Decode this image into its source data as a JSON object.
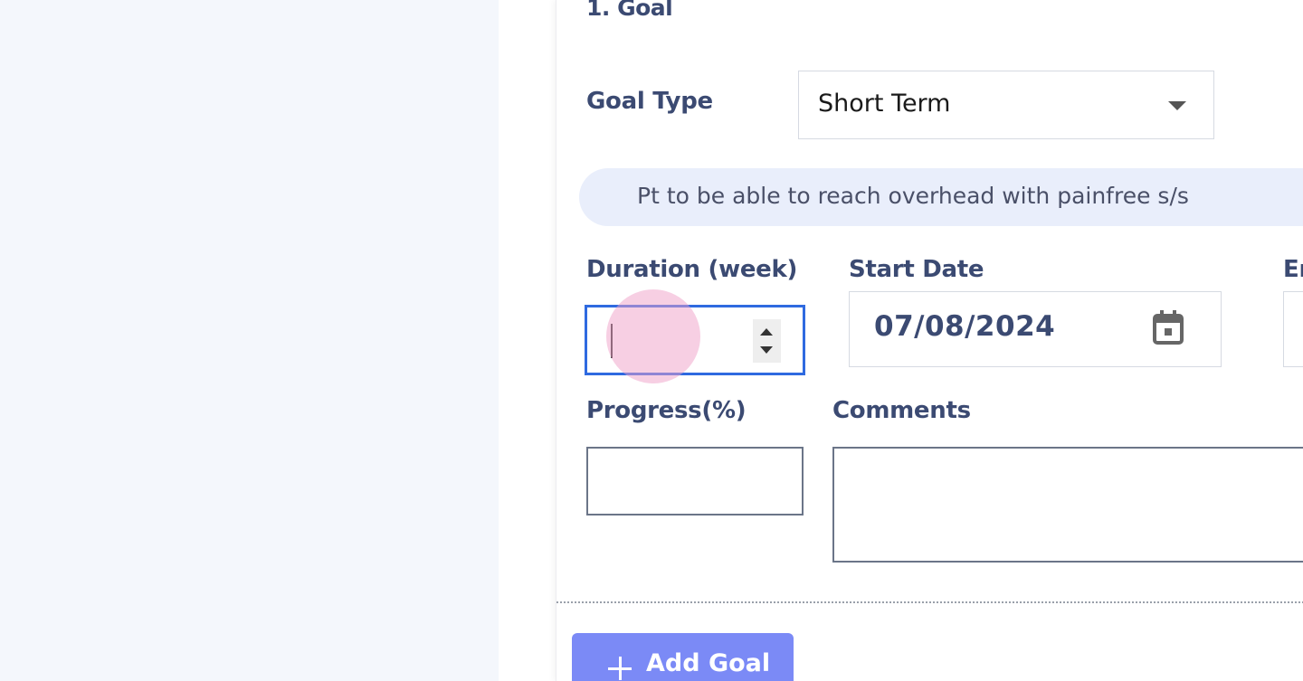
{
  "goal_section": {
    "title": "1. Goal",
    "goal_type_label": "Goal Type",
    "goal_type_value": "Short Term",
    "goal_description": "Pt to be able to reach overhead with painfree s/s",
    "duration_label": "Duration (week)",
    "duration_value": "",
    "start_date_label": "Start Date",
    "start_date_value": "07/08/2024",
    "end_date_label": "En",
    "progress_label": "Progress(%)",
    "progress_value": "",
    "comments_label": "Comments",
    "comments_value": ""
  },
  "actions": {
    "add_goal_label": "Add Goal"
  },
  "icons": {
    "select": "chevron-down-icon",
    "calendar": "calendar-icon",
    "add": "plus-icon"
  },
  "colors": {
    "label": "#3b4a72",
    "focus_border": "#2f6ae0",
    "pill_bg": "#e9eefb",
    "button_bg": "#7b8af6"
  }
}
